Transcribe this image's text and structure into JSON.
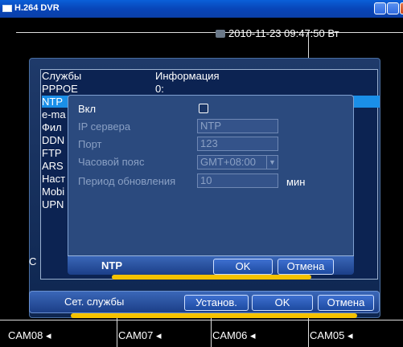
{
  "window": {
    "title": "H.264 DVR"
  },
  "overlay": {
    "datetime": "2010-11-23 09:47:50 Вт"
  },
  "cameras": [
    "CAM08",
    "CAM07",
    "CAM06",
    "CAM05"
  ],
  "services_window": {
    "title": "Сет. службы",
    "col_service": "Службы",
    "col_info": "Информация",
    "items": [
      "PPPOE",
      "NTP",
      "e-ma",
      "Фил",
      "DDN",
      "FTP",
      "ARS",
      "Наст",
      "Mobi",
      "UPN"
    ],
    "first_info": "0:",
    "side_letter": "C",
    "buttons": {
      "apply": "Установ.",
      "ok": "OK",
      "cancel": "Отмена"
    }
  },
  "ntp_dialog": {
    "title": "NTP",
    "enable_label": "Вкл",
    "server_label": "IP сервера",
    "server_value": "NTP",
    "port_label": "Порт",
    "port_value": "123",
    "tz_label": "Часовой пояс",
    "tz_value": "GMT+08:00",
    "period_label": "Период обновления",
    "period_value": "10",
    "period_unit": "мин",
    "buttons": {
      "ok": "OK",
      "cancel": "Отмена"
    }
  },
  "colors": {
    "accent": "#1a8fe8",
    "glow": "#f5c200"
  }
}
